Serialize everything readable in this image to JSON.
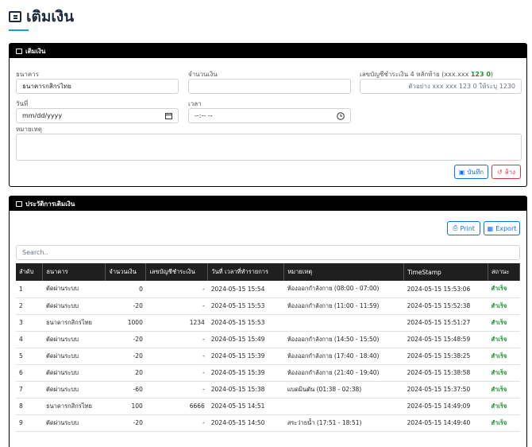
{
  "page": {
    "title": "เติมเงิน"
  },
  "form": {
    "header": "เติมเงิน",
    "bank": {
      "label": "ธนาคาร",
      "value": "ธนาคารกสิกรไทย"
    },
    "amount": {
      "label": "จำนวนเงิน",
      "value": ""
    },
    "account": {
      "label_prefix": "เลขบัญชีชำระเงิน 4 หลักท้าย (xxx.xxx ",
      "label_highlight": "123 0",
      "label_suffix": ")",
      "placeholder": "ตัวอย่าง xxx xxx 123 0 ให้ระบุ 1230"
    },
    "date": {
      "label": "วันที่",
      "placeholder": "mm/dd/yyyy"
    },
    "time": {
      "label": "เวลา",
      "placeholder": "--:-- --"
    },
    "note": {
      "label": "หมายเหตุ",
      "value": ""
    },
    "save_label": "บันทึก",
    "clear_label": "ล้าง"
  },
  "history": {
    "header": "ประวัติการเติมเงิน",
    "print_label": "Print",
    "export_label": "Export",
    "search_placeholder": "Search..",
    "columns": [
      "ลำดับ",
      "ธนาคาร",
      "จำนวนเงิน",
      "เลขบัญชีชำระเงิน",
      "วันที่ เวลาที่ทำรายการ",
      "หมายเหตุ",
      "TimeStamp",
      "สถานะ"
    ],
    "rows": [
      [
        "1",
        "ตัดผ่านระบบ",
        "0",
        "-",
        "2024-05-15 15:54",
        "ห้องออกกำลังกาย (08:00 - 07:00)",
        "2024-05-15 15:53:06",
        "สำเร็จ"
      ],
      [
        "2",
        "ตัดผ่านระบบ",
        "-20",
        "-",
        "2024-05-15 15:53",
        "ห้องออกกำลังกาย (11:00 - 11:59)",
        "2024-05-15 15:52:38",
        "สำเร็จ"
      ],
      [
        "3",
        "ธนาคารกสิกรไทย",
        "1000",
        "1234",
        "2024-05-15 15:53",
        "",
        "2024-05-15 15:51:27",
        "สำเร็จ"
      ],
      [
        "4",
        "ตัดผ่านระบบ",
        "-20",
        "-",
        "2024-05-15 15:49",
        "ห้องออกกำลังกาย (14:50 - 15:50)",
        "2024-05-15 15:48:59",
        "สำเร็จ"
      ],
      [
        "5",
        "ตัดผ่านระบบ",
        "-20",
        "-",
        "2024-05-15 15:39",
        "ห้องออกกำลังกาย (17:40 - 18:40)",
        "2024-05-15 15:38:25",
        "สำเร็จ"
      ],
      [
        "6",
        "ตัดผ่านระบบ",
        "20",
        "-",
        "2024-05-15 15:39",
        "ห้องออกกำลังกาย (21:40 - 19:40)",
        "2024-05-15 15:38:58",
        "สำเร็จ"
      ],
      [
        "7",
        "ตัดผ่านระบบ",
        "-60",
        "-",
        "2024-05-15 15:38",
        "แบดมินตัน (01:38 - 02:38)",
        "2024-05-15 15:37:50",
        "สำเร็จ"
      ],
      [
        "8",
        "ธนาคารกสิกรไทย",
        "100",
        "6666",
        "2024-05-15 14:51",
        "",
        "2024-05-15 14:49:09",
        "สำเร็จ"
      ],
      [
        "9",
        "ตัดผ่านระบบ",
        "-20",
        "-",
        "2024-05-15 14:50",
        "สระว่ายน้ำ (17:51 - 18:51)",
        "2024-05-15 14:49:40",
        "สำเร็จ"
      ]
    ]
  },
  "colors": {
    "accent": "#1a9bd7",
    "success": "#1f8f2f",
    "primary": "#0d6efd",
    "danger": "#dc3545"
  }
}
